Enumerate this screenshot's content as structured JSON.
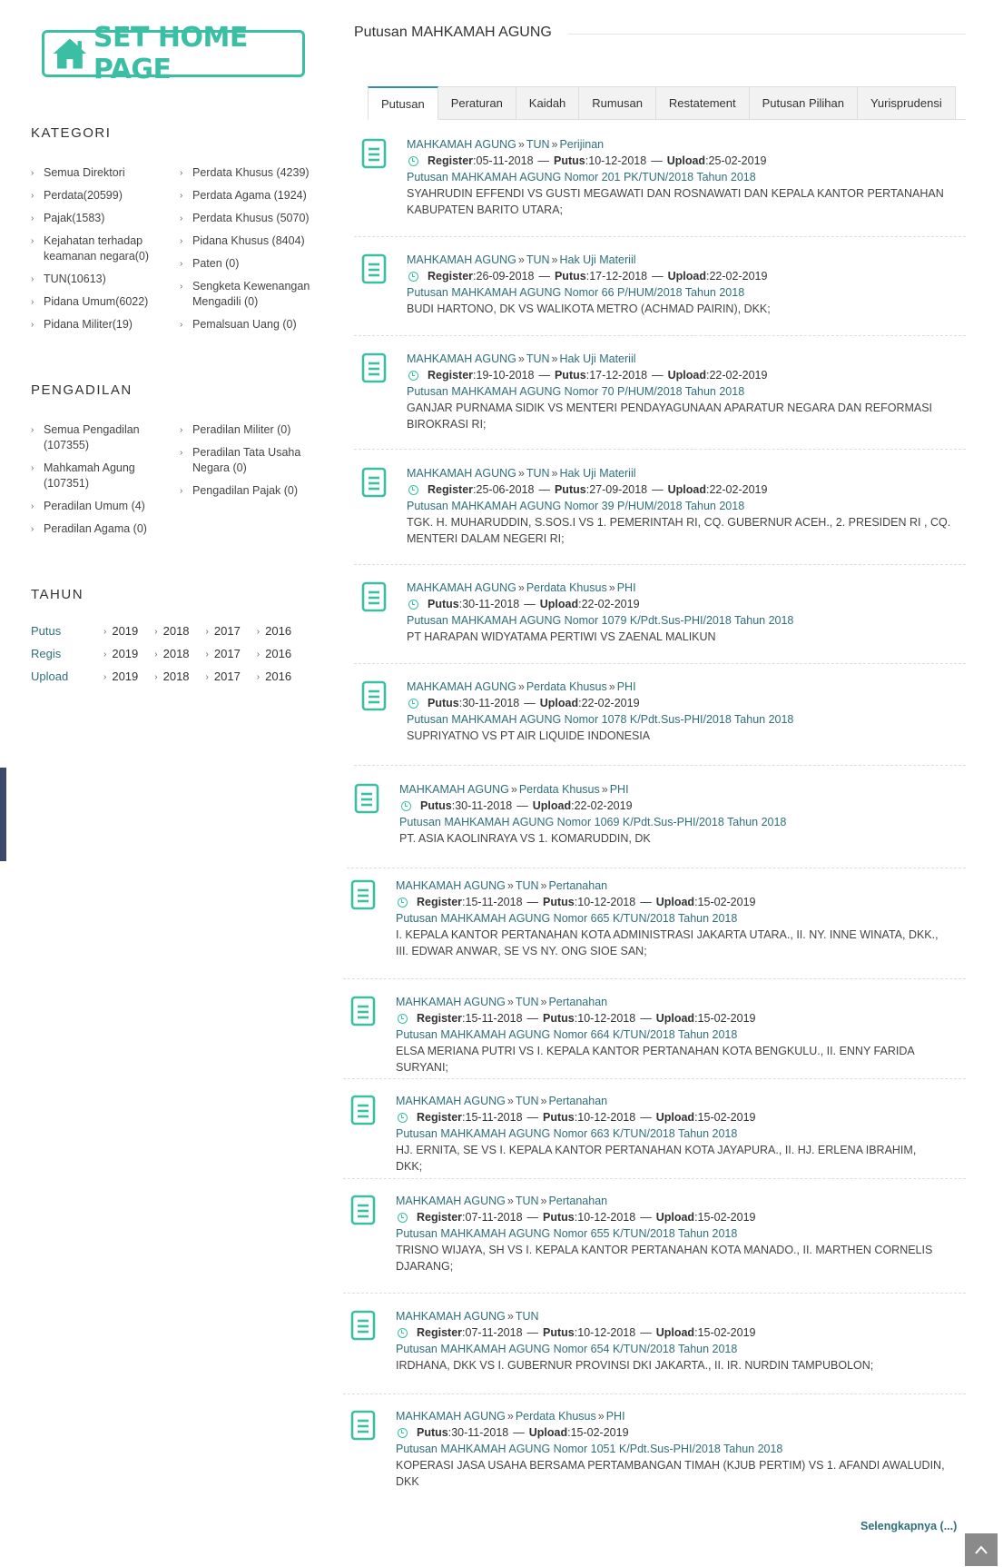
{
  "home_button": {
    "label": "SET HOME PAGE"
  },
  "kategori": {
    "heading": "KATEGORI",
    "col1": [
      "Semua Direktori",
      "Perdata(20599)",
      "Pajak(1583)",
      "Kejahatan terhadap keamanan negara(0)",
      "TUN(10613)",
      "Pidana Umum(6022)",
      "Pidana Militer(19)"
    ],
    "col2": [
      "Perdata Khusus (4239)",
      "Perdata Agama (1924)",
      "Perdata Khusus (5070)",
      "Pidana Khusus (8404)",
      "Paten (0)",
      "Sengketa Kewenangan Mengadili (0)",
      "Pemalsuan Uang (0)"
    ]
  },
  "pengadilan": {
    "heading": "PENGADILAN",
    "col1": [
      "Semua Pengadilan (107355)",
      "Mahkamah Agung (107351)",
      "Peradilan Umum (4)",
      "Peradilan Agama (0)"
    ],
    "col2": [
      "Peradilan Militer (0)",
      "Peradilan Tata Usaha Negara (0)",
      "Pengadilan Pajak (0)"
    ]
  },
  "tahun": {
    "heading": "TAHUN",
    "rows": [
      {
        "label": "Putus",
        "years": [
          "2019",
          "2018",
          "2017",
          "2016"
        ]
      },
      {
        "label": "Regis",
        "years": [
          "2019",
          "2018",
          "2017",
          "2016"
        ]
      },
      {
        "label": "Upload",
        "years": [
          "2019",
          "2018",
          "2017",
          "2016"
        ]
      }
    ]
  },
  "main": {
    "title": "Putusan MAHKAMAH AGUNG",
    "tabs": [
      "Putusan",
      "Peraturan",
      "Kaidah",
      "Rumusan",
      "Restatement",
      "Putusan Pilihan",
      "Yurisprudensi"
    ],
    "active_tab": "Putusan",
    "more_label": "Selengkapnya (...)"
  },
  "entries": [
    {
      "crumbs": [
        "MAHKAMAH AGUNG",
        "TUN",
        "Perijinan"
      ],
      "meta": [
        [
          "Register",
          "05-11-2018"
        ],
        [
          "Putus",
          "10-12-2018"
        ],
        [
          "Upload",
          "25-02-2019"
        ]
      ],
      "title": "Putusan MAHKAMAH AGUNG Nomor 201 PK/TUN/2018 Tahun 2018",
      "parties": "SYAHRUDIN EFFENDI VS GUSTI MEGAWATI DAN ROSNAWATI DAN KEPALA KANTOR PERTANAHAN KABUPATEN BARITO UTARA;"
    },
    {
      "crumbs": [
        "MAHKAMAH AGUNG",
        "TUN",
        "Hak Uji Materiil"
      ],
      "meta": [
        [
          "Register",
          "26-09-2018"
        ],
        [
          "Putus",
          "17-12-2018"
        ],
        [
          "Upload",
          "22-02-2019"
        ]
      ],
      "title": "Putusan MAHKAMAH AGUNG Nomor 66 P/HUM/2018 Tahun 2018",
      "parties": "BUDI HARTONO, DK VS WALIKOTA METRO (ACHMAD PAIRIN), DKK;"
    },
    {
      "crumbs": [
        "MAHKAMAH AGUNG",
        "TUN",
        "Hak Uji Materiil"
      ],
      "meta": [
        [
          "Register",
          "19-10-2018"
        ],
        [
          "Putus",
          "17-12-2018"
        ],
        [
          "Upload",
          "22-02-2019"
        ]
      ],
      "title": "Putusan MAHKAMAH AGUNG Nomor 70 P/HUM/2018 Tahun 2018",
      "parties": "GANJAR PURNAMA SIDIK VS MENTERI PENDAYAGUNAAN APARATUR NEGARA DAN REFORMASI BIROKRASI RI;"
    },
    {
      "crumbs": [
        "MAHKAMAH AGUNG",
        "TUN",
        "Hak Uji Materiil"
      ],
      "meta": [
        [
          "Register",
          "25-06-2018"
        ],
        [
          "Putus",
          "27-09-2018"
        ],
        [
          "Upload",
          "22-02-2019"
        ]
      ],
      "title": "Putusan MAHKAMAH AGUNG Nomor 39 P/HUM/2018 Tahun 2018",
      "parties": "TGK. H. MUHARUDDIN, S.SOS.I VS 1. PEMERINTAH RI, CQ. GUBERNUR ACEH., 2. PRESIDEN RI , CQ. MENTERI DALAM NEGERI RI;"
    },
    {
      "crumbs": [
        "MAHKAMAH AGUNG",
        "Perdata Khusus",
        "PHI"
      ],
      "meta": [
        [
          "Putus",
          "30-11-2018"
        ],
        [
          "Upload",
          "22-02-2019"
        ]
      ],
      "title": "Putusan MAHKAMAH AGUNG Nomor 1079 K/Pdt.Sus-PHI/2018 Tahun 2018",
      "parties": "PT HARAPAN WIDYATAMA PERTIWI VS ZAENAL MALIKUN"
    },
    {
      "crumbs": [
        "MAHKAMAH AGUNG",
        "Perdata Khusus",
        "PHI"
      ],
      "meta": [
        [
          "Putus",
          "30-11-2018"
        ],
        [
          "Upload",
          "22-02-2019"
        ]
      ],
      "title": "Putusan MAHKAMAH AGUNG Nomor 1078 K/Pdt.Sus-PHI/2018 Tahun 2018",
      "parties": "SUPRIYATNO VS PT AIR LIQUIDE INDONESIA"
    },
    {
      "crumbs": [
        "MAHKAMAH AGUNG",
        "Perdata Khusus",
        "PHI"
      ],
      "meta": [
        [
          "Putus",
          "30-11-2018"
        ],
        [
          "Upload",
          "22-02-2019"
        ]
      ],
      "title": "Putusan MAHKAMAH AGUNG Nomor 1069 K/Pdt.Sus-PHI/2018 Tahun 2018",
      "parties": "PT. ASIA KAOLINRAYA VS 1. KOMARUDDIN, DK"
    },
    {
      "crumbs": [
        "MAHKAMAH AGUNG",
        "TUN",
        "Pertanahan"
      ],
      "meta": [
        [
          "Register",
          "15-11-2018"
        ],
        [
          "Putus",
          "10-12-2018"
        ],
        [
          "Upload",
          "15-02-2019"
        ]
      ],
      "title": "Putusan MAHKAMAH AGUNG Nomor 665 K/TUN/2018 Tahun 2018",
      "parties": "I. KEPALA KANTOR PERTANAHAN KOTA ADMINISTRASI JAKARTA UTARA., II. NY. INNE WINATA, DKK., III. EDWAR ANWAR, SE VS NY. ONG SIOE SAN;"
    },
    {
      "crumbs": [
        "MAHKAMAH AGUNG",
        "TUN",
        "Pertanahan"
      ],
      "meta": [
        [
          "Register",
          "15-11-2018"
        ],
        [
          "Putus",
          "10-12-2018"
        ],
        [
          "Upload",
          "15-02-2019"
        ]
      ],
      "title": "Putusan MAHKAMAH AGUNG Nomor 664 K/TUN/2018 Tahun 2018",
      "parties": "ELSA MERIANA PUTRI VS I. KEPALA KANTOR PERTANAHAN KOTA BENGKULU., II. ENNY FARIDA SURYANI;"
    },
    {
      "crumbs": [
        "MAHKAMAH AGUNG",
        "TUN",
        "Pertanahan"
      ],
      "meta": [
        [
          "Register",
          "15-11-2018"
        ],
        [
          "Putus",
          "10-12-2018"
        ],
        [
          "Upload",
          "15-02-2019"
        ]
      ],
      "title": "Putusan MAHKAMAH AGUNG Nomor 663 K/TUN/2018 Tahun 2018",
      "parties": "HJ. ERNITA, SE VS I. KEPALA KANTOR PERTANAHAN KOTA JAYAPURA., II. HJ. ERLENA IBRAHIM, DKK;"
    },
    {
      "crumbs": [
        "MAHKAMAH AGUNG",
        "TUN",
        "Pertanahan"
      ],
      "meta": [
        [
          "Register",
          "07-11-2018"
        ],
        [
          "Putus",
          "10-12-2018"
        ],
        [
          "Upload",
          "15-02-2019"
        ]
      ],
      "title": "Putusan MAHKAMAH AGUNG Nomor 655 K/TUN/2018 Tahun 2018",
      "parties": "TRISNO WIJAYA, SH VS I. KEPALA KANTOR PERTANAHAN KOTA MANADO., II. MARTHEN CORNELIS DJARANG;"
    },
    {
      "crumbs": [
        "MAHKAMAH AGUNG",
        "TUN"
      ],
      "meta": [
        [
          "Register",
          "07-11-2018"
        ],
        [
          "Putus",
          "10-12-2018"
        ],
        [
          "Upload",
          "15-02-2019"
        ]
      ],
      "title": "Putusan MAHKAMAH AGUNG Nomor 654 K/TUN/2018 Tahun 2018",
      "parties": "IRDHANA, DKK VS I. GUBERNUR PROVINSI DKI JAKARTA., II. IR. NURDIN TAMPUBOLON;"
    },
    {
      "crumbs": [
        "MAHKAMAH AGUNG",
        "Perdata Khusus",
        "PHI"
      ],
      "meta": [
        [
          "Putus",
          "30-11-2018"
        ],
        [
          "Upload",
          "15-02-2019"
        ]
      ],
      "title": "Putusan MAHKAMAH AGUNG Nomor 1051 K/Pdt.Sus-PHI/2018 Tahun 2018",
      "parties": "KOPERASI JASA USAHA BERSAMA PERTAMBANGAN TIMAH (KJUB PERTIM) VS 1. AFANDI AWALUDIN, DKK"
    }
  ],
  "colors": {
    "accent": "#3bbfa4",
    "link": "#2f6f7a",
    "edge_bar": "#3b4a6b"
  },
  "icons": {
    "home": "house-icon",
    "entry": "document-icon",
    "clock": "clock-icon",
    "arrow": "chevron-right-icon",
    "scroll_top": "arrow-up-icon"
  }
}
